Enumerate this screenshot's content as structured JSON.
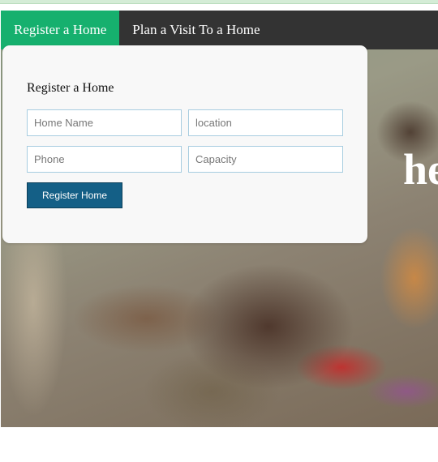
{
  "nav": {
    "tabs": [
      {
        "label": "Register a Home",
        "active": true
      },
      {
        "label": "Plan a Visit To a Home",
        "active": false
      }
    ]
  },
  "hero": {
    "text": "he"
  },
  "form": {
    "title": "Register a Home",
    "fields": {
      "home_name": {
        "placeholder": "Home Name",
        "value": ""
      },
      "location": {
        "placeholder": "location",
        "value": ""
      },
      "phone": {
        "placeholder": "Phone",
        "value": ""
      },
      "capacity": {
        "placeholder": "Capacity",
        "value": ""
      }
    },
    "submit_label": "Register Home"
  },
  "colors": {
    "active_tab": "#16b06e",
    "navbar": "#333333",
    "button": "#145f86",
    "input_border": "#a7cde0"
  }
}
